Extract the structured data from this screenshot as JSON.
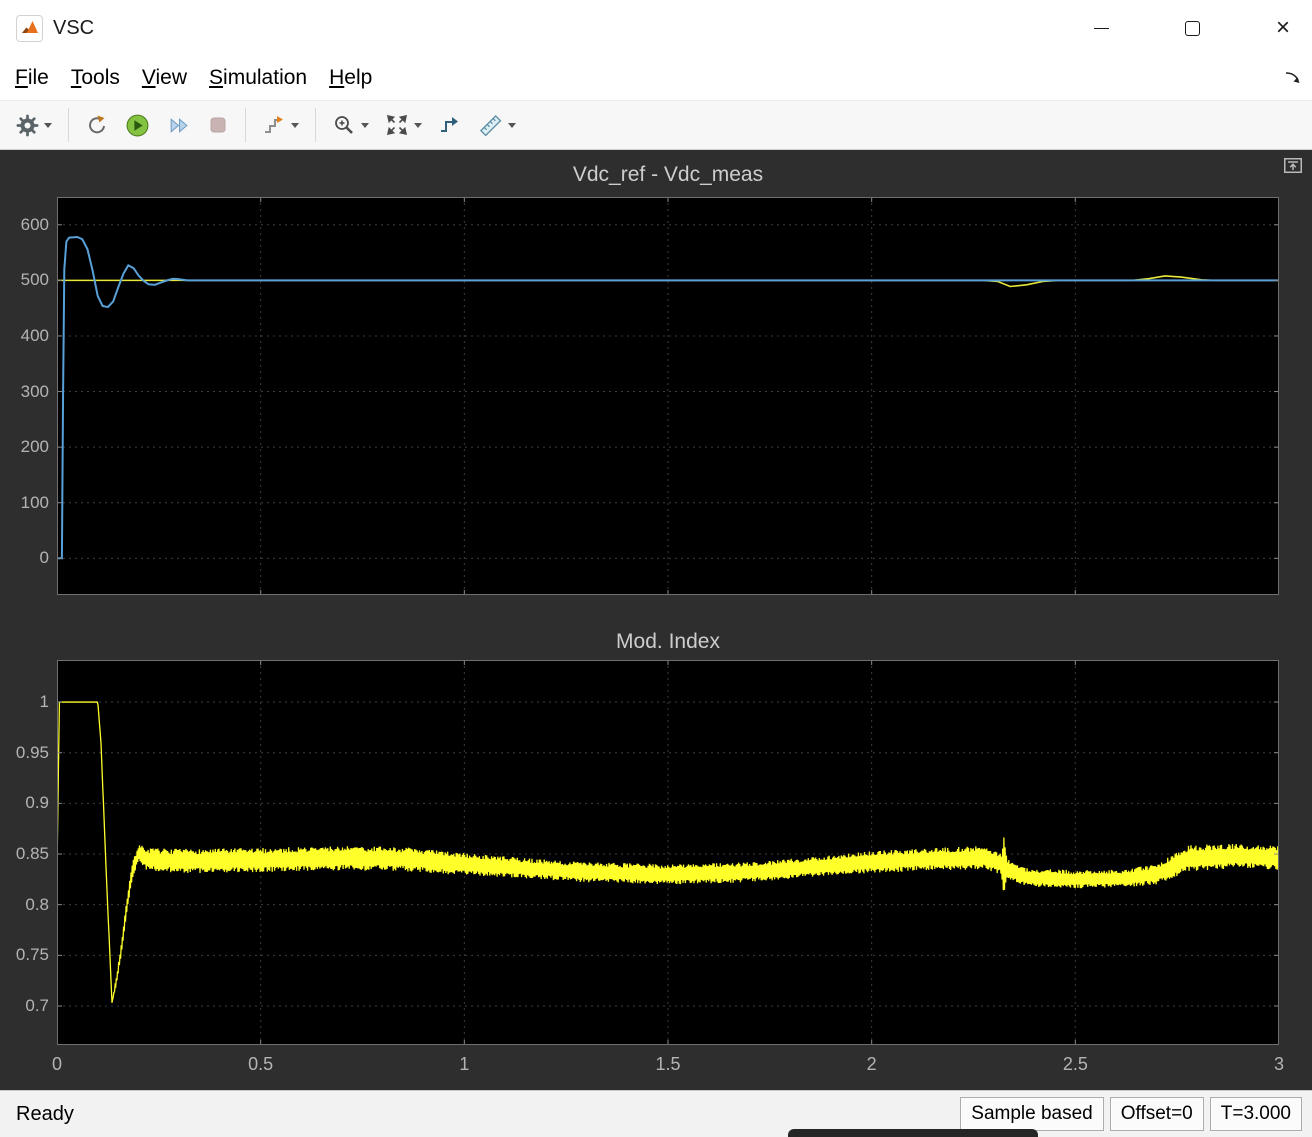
{
  "window": {
    "title": "VSC"
  },
  "menu": {
    "items": [
      {
        "label": "File",
        "accel": 0
      },
      {
        "label": "Tools",
        "accel": 0
      },
      {
        "label": "View",
        "accel": 0
      },
      {
        "label": "Simulation",
        "accel": 0
      },
      {
        "label": "Help",
        "accel": 0
      }
    ]
  },
  "toolbar": {
    "items": [
      {
        "name": "configuration",
        "icon": "gear-icon",
        "dropdown": true
      },
      {
        "type": "separator"
      },
      {
        "name": "step-back",
        "icon": "step-back-icon"
      },
      {
        "name": "run",
        "icon": "run-icon"
      },
      {
        "name": "step-forward",
        "icon": "step-forward-icon"
      },
      {
        "name": "stop",
        "icon": "stop-icon",
        "disabled": true
      },
      {
        "type": "separator"
      },
      {
        "name": "simulation-stepping-options",
        "icon": "stepping-options-icon",
        "dropdown": true
      },
      {
        "type": "separator"
      },
      {
        "name": "zoom",
        "icon": "zoom-in-icon",
        "dropdown": true
      },
      {
        "name": "fit-to-view",
        "icon": "fit-to-view-icon",
        "dropdown": true
      },
      {
        "name": "highlight-simulink-block",
        "icon": "highlight-block-icon"
      },
      {
        "name": "cursor-measurements",
        "icon": "cursor-measurements-icon",
        "dropdown": true
      }
    ]
  },
  "chart_data": [
    {
      "type": "line",
      "title": "Vdc_ref - Vdc_meas",
      "xlim": [
        0,
        3
      ],
      "ylim": [
        -66,
        650
      ],
      "x_ticks": [
        0,
        0.5,
        1,
        1.5,
        2,
        2.5,
        3
      ],
      "y_ticks": [
        0,
        100,
        200,
        300,
        400,
        500,
        600
      ],
      "show_x_labels": false,
      "grid": true,
      "background": "#000000",
      "series": [
        {
          "name": "Vdc_ref",
          "color": "#e8e83a",
          "width": 1.6,
          "points": [
            [
              0,
              500
            ],
            [
              2.27,
              500
            ],
            [
              2.31,
              498
            ],
            [
              2.34,
              489
            ],
            [
              2.38,
              492
            ],
            [
              2.42,
              498
            ],
            [
              2.46,
              500
            ],
            [
              2.64,
              500
            ],
            [
              2.68,
              503
            ],
            [
              2.72,
              508
            ],
            [
              2.76,
              506
            ],
            [
              2.81,
              501
            ],
            [
              2.84,
              500
            ],
            [
              3,
              500
            ]
          ]
        },
        {
          "name": "Vdc_meas",
          "color": "#58a0d8",
          "width": 2,
          "points": [
            [
              0,
              0
            ],
            [
              0.012,
              0
            ],
            [
              0.015,
              300
            ],
            [
              0.018,
              520
            ],
            [
              0.023,
              570
            ],
            [
              0.03,
              577
            ],
            [
              0.05,
              578
            ],
            [
              0.062,
              574
            ],
            [
              0.075,
              556
            ],
            [
              0.088,
              516
            ],
            [
              0.1,
              472
            ],
            [
              0.112,
              454
            ],
            [
              0.125,
              452
            ],
            [
              0.138,
              462
            ],
            [
              0.15,
              487
            ],
            [
              0.163,
              512
            ],
            [
              0.175,
              527
            ],
            [
              0.188,
              522
            ],
            [
              0.2,
              509
            ],
            [
              0.213,
              499
            ],
            [
              0.225,
              493
            ],
            [
              0.24,
              492
            ],
            [
              0.255,
              496
            ],
            [
              0.27,
              500
            ],
            [
              0.285,
              503
            ],
            [
              0.3,
              502
            ],
            [
              0.32,
              500
            ],
            [
              3,
              500
            ]
          ]
        }
      ]
    },
    {
      "type": "line",
      "title": "Mod. Index",
      "xlim": [
        0,
        3
      ],
      "ylim": [
        0.6615,
        1.0415
      ],
      "x_ticks": [
        0,
        0.5,
        1,
        1.5,
        2,
        2.5,
        3
      ],
      "y_ticks": [
        0.7,
        0.75,
        0.8,
        0.85,
        0.9,
        0.95,
        1
      ],
      "show_x_labels": true,
      "grid": true,
      "background": "#000000",
      "series": [
        {
          "name": "Mod Index",
          "color": "#ffff2a",
          "width": 1.3,
          "envelope": [
            [
              0,
              0.835,
              0
            ],
            [
              0.006,
              1.0,
              0
            ],
            [
              0.1,
              1.0,
              0
            ],
            [
              0.108,
              0.96,
              0
            ],
            [
              0.12,
              0.84,
              0
            ],
            [
              0.135,
              0.703,
              0
            ],
            [
              0.148,
              0.73,
              0.004
            ],
            [
              0.16,
              0.762,
              0.006
            ],
            [
              0.172,
              0.8,
              0.007
            ],
            [
              0.185,
              0.833,
              0.008
            ],
            [
              0.2,
              0.851,
              0.009
            ],
            [
              0.22,
              0.845,
              0.011
            ],
            [
              0.3,
              0.843,
              0.012
            ],
            [
              0.5,
              0.844,
              0.012
            ],
            [
              0.7,
              0.846,
              0.012
            ],
            [
              0.85,
              0.845,
              0.012
            ],
            [
              1.0,
              0.84,
              0.011
            ],
            [
              1.15,
              0.836,
              0.01
            ],
            [
              1.3,
              0.832,
              0.01
            ],
            [
              1.5,
              0.83,
              0.01
            ],
            [
              1.7,
              0.832,
              0.01
            ],
            [
              1.85,
              0.837,
              0.01
            ],
            [
              2.0,
              0.842,
              0.011
            ],
            [
              2.15,
              0.845,
              0.011
            ],
            [
              2.28,
              0.846,
              0.012
            ],
            [
              2.318,
              0.84,
              0.01
            ],
            [
              2.325,
              0.838,
              0.034
            ],
            [
              2.332,
              0.835,
              0.01
            ],
            [
              2.38,
              0.827,
              0.009
            ],
            [
              2.5,
              0.825,
              0.009
            ],
            [
              2.62,
              0.826,
              0.009
            ],
            [
              2.7,
              0.83,
              0.01
            ],
            [
              2.74,
              0.838,
              0.012
            ],
            [
              2.78,
              0.846,
              0.013
            ],
            [
              2.9,
              0.848,
              0.012
            ],
            [
              3.0,
              0.846,
              0.012
            ]
          ]
        }
      ]
    }
  ],
  "status_bar": {
    "left": "Ready",
    "items": [
      {
        "name": "sample-mode",
        "text": "Sample based"
      },
      {
        "name": "offset",
        "text": "Offset=0"
      },
      {
        "name": "time",
        "text": "T=3.000"
      }
    ]
  }
}
